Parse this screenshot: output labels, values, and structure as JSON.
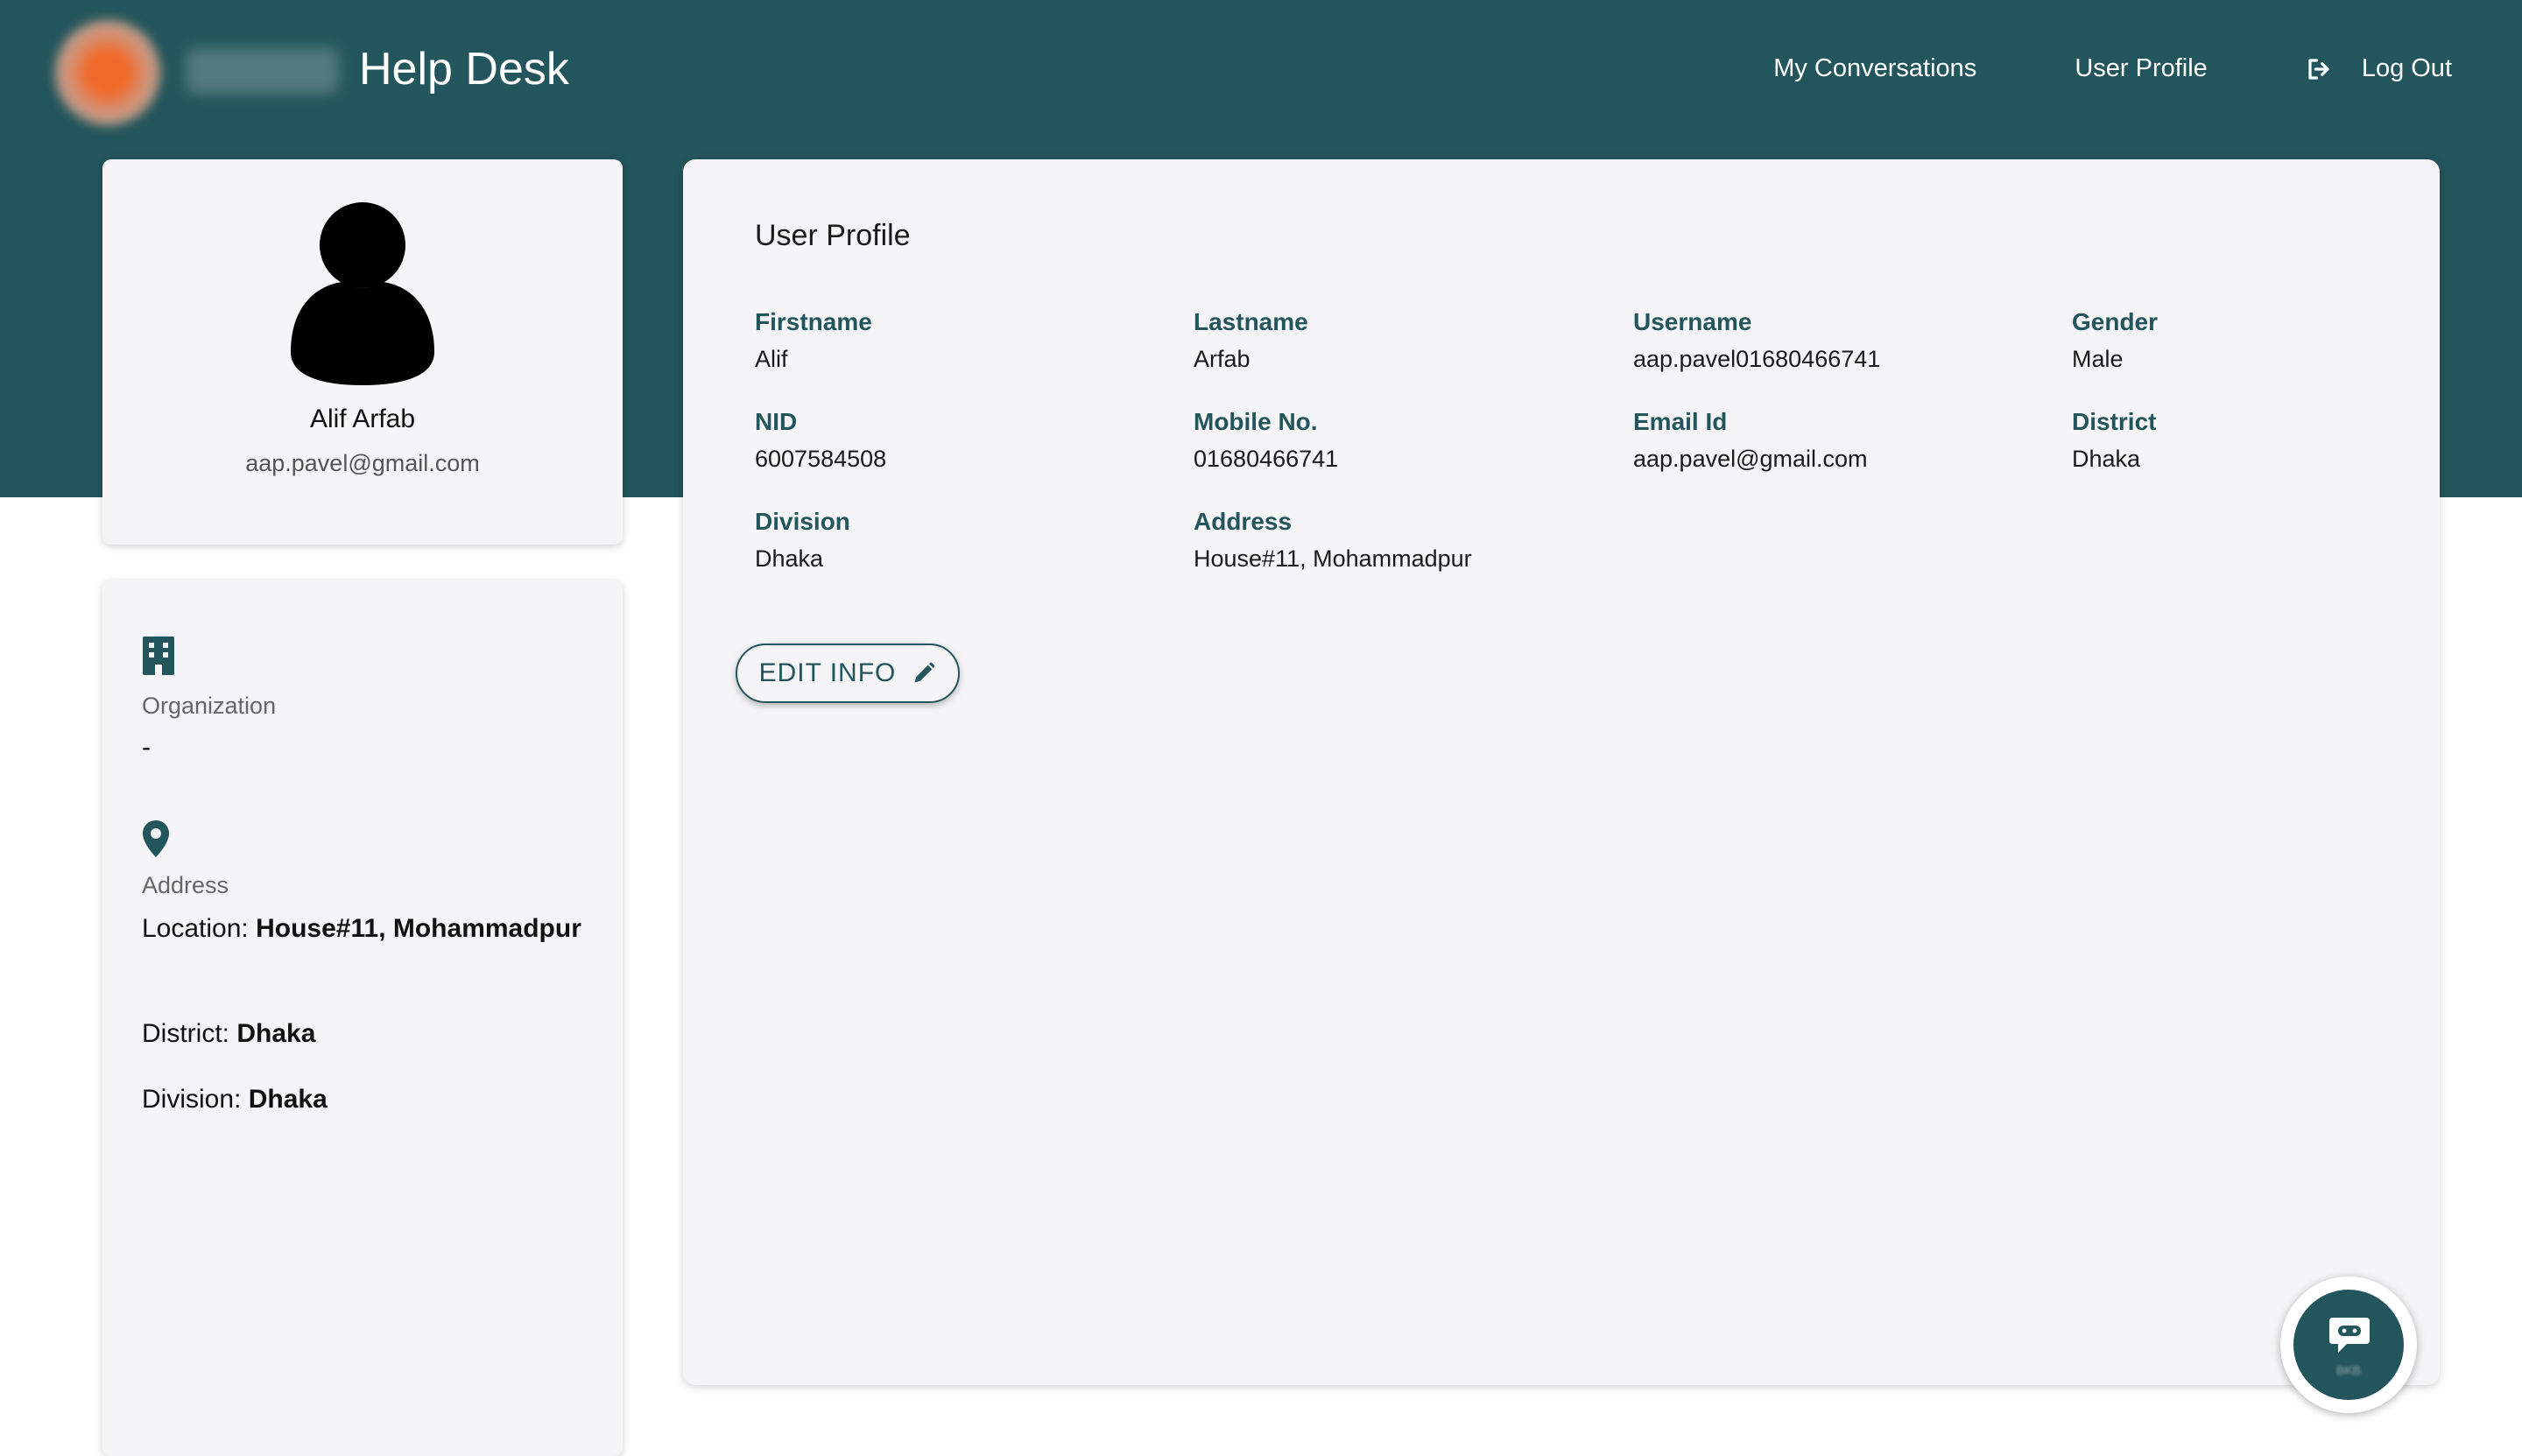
{
  "header": {
    "title": "Help Desk",
    "nav": [
      {
        "label": "My Conversations",
        "icon": ""
      },
      {
        "label": "User Profile",
        "icon": ""
      },
      {
        "label": "Log Out",
        "icon": "logout-icon"
      }
    ]
  },
  "profile_card": {
    "name": "Alif Arfab",
    "email": "aap.pavel@gmail.com",
    "avatar_icon": "user-avatar-icon"
  },
  "info_card": {
    "organization": {
      "icon": "building-icon",
      "label": "Organization",
      "value": "-"
    },
    "address": {
      "icon": "location-pin-icon",
      "label": "Address",
      "location_label": "Location:",
      "location_value": "House#11, Mohammadpur",
      "district_label": "District:",
      "district_value": "Dhaka",
      "division_label": "Division:",
      "division_value": "Dhaka"
    }
  },
  "user_profile": {
    "title": "User Profile",
    "fields": [
      {
        "label": "Firstname",
        "value": "Alif"
      },
      {
        "label": "Lastname",
        "value": "Arfab"
      },
      {
        "label": "Username",
        "value": "aap.pavel01680466741"
      },
      {
        "label": "Gender",
        "value": "Male"
      },
      {
        "label": "NID",
        "value": "6007584508"
      },
      {
        "label": "Mobile No.",
        "value": "01680466741"
      },
      {
        "label": "Email Id",
        "value": "aap.pavel@gmail.com"
      },
      {
        "label": "District",
        "value": "Dhaka"
      },
      {
        "label": "Division",
        "value": "Dhaka"
      },
      {
        "label": "Address",
        "value": "House#11, Mohammadpur"
      }
    ],
    "edit_button": {
      "label": "EDIT INFO",
      "icon": "pencil-icon"
    }
  },
  "chat_widget": {
    "icon": "chatbot-icon",
    "label": "BKB"
  },
  "colors": {
    "primary": "#23555c",
    "card_bg": "#f5f5f7",
    "page_bg": "#ffffff"
  }
}
